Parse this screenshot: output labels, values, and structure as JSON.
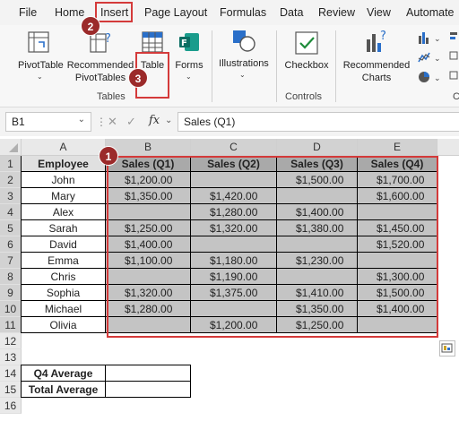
{
  "menu": [
    "File",
    "Home",
    "Insert",
    "Page Layout",
    "Formulas",
    "Data",
    "Review",
    "View",
    "Automate"
  ],
  "ribbon": {
    "pivot_table": "PivotTable",
    "recommended_pivot_1": "Recommended",
    "recommended_pivot_2": "PivotTables",
    "table": "Table",
    "forms": "Forms",
    "illustrations": "Illustrations",
    "checkbox": "Checkbox",
    "recommended_charts_1": "Recommended",
    "recommended_charts_2": "Charts",
    "group_tables": "Tables",
    "group_controls": "Controls",
    "group_c": "C"
  },
  "badges": [
    "1",
    "2",
    "3"
  ],
  "formula_bar": {
    "name_box": "B1",
    "fx": "fx",
    "content": "Sales (Q1)"
  },
  "columns": [
    "A",
    "B",
    "C",
    "D",
    "E"
  ],
  "rows": [
    "1",
    "2",
    "3",
    "4",
    "5",
    "6",
    "7",
    "8",
    "9",
    "10",
    "11",
    "12",
    "13",
    "14",
    "15",
    "16"
  ],
  "table": {
    "headers": [
      "Employee",
      "Sales (Q1)",
      "Sales (Q2)",
      "Sales (Q3)",
      "Sales (Q4)"
    ],
    "rows": [
      [
        "John",
        "$1,200.00",
        "",
        "$1,500.00",
        "$1,700.00"
      ],
      [
        "Mary",
        "$1,350.00",
        "$1,420.00",
        "",
        "$1,600.00"
      ],
      [
        "Alex",
        "",
        "$1,280.00",
        "$1,400.00",
        ""
      ],
      [
        "Sarah",
        "$1,250.00",
        "$1,320.00",
        "$1,380.00",
        "$1,450.00"
      ],
      [
        "David",
        "$1,400.00",
        "",
        "",
        "$1,520.00"
      ],
      [
        "Emma",
        "$1,100.00",
        "$1,180.00",
        "$1,230.00",
        ""
      ],
      [
        "Chris",
        "",
        "$1,190.00",
        "",
        "$1,300.00"
      ],
      [
        "Sophia",
        "$1,320.00",
        "$1,375.00",
        "$1,410.00",
        "$1,500.00"
      ],
      [
        "Michael",
        "$1,280.00",
        "",
        "$1,350.00",
        "$1,400.00"
      ],
      [
        "Olivia",
        "",
        "$1,200.00",
        "$1,250.00",
        ""
      ]
    ]
  },
  "summary": {
    "q4_average": "Q4 Average",
    "total_average": "Total Average"
  },
  "colors": {
    "accent_red": "#d43a3a",
    "badge": "#9b2a2a",
    "header_fill": "#a9a9a9",
    "data_fill": "#c4c4c4"
  }
}
